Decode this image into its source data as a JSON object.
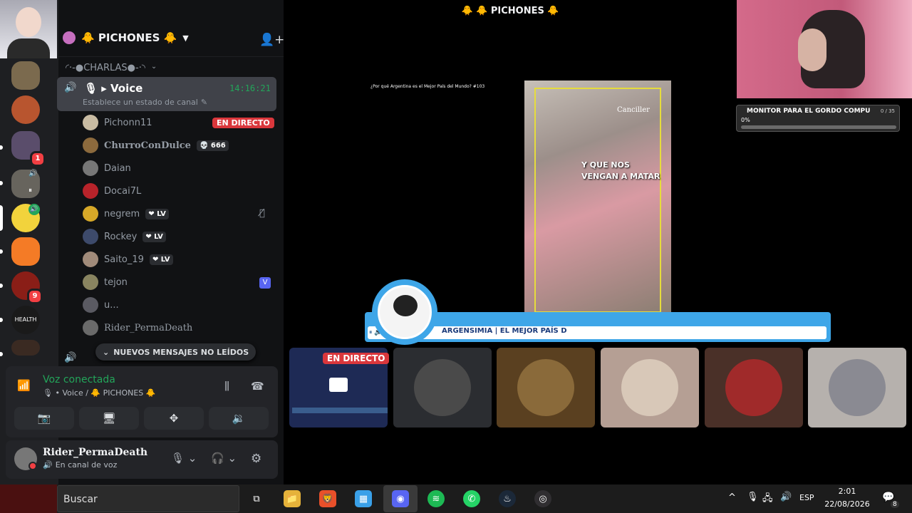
{
  "server": {
    "name": "🐥 PICHONES 🐥",
    "top_title": "🐥 🐥 PICHONES 🐥"
  },
  "category": {
    "label": "◜·-●CHARLAS●-·◝"
  },
  "channel": {
    "name": "🎙 ▸ Voice",
    "timer": "14:16:21",
    "status_placeholder": "Establece un estado de canal"
  },
  "members": [
    {
      "name": "Pichonn11",
      "tag": "EN DIRECTO"
    },
    {
      "name": "ChurroConDulce",
      "tag": "💀 666"
    },
    {
      "name": "Daian",
      "tag": ""
    },
    {
      "name": "Docai7L",
      "tag": ""
    },
    {
      "name": "negrem",
      "tag": "❤ LV"
    },
    {
      "name": "Rockey",
      "tag": "❤ LV"
    },
    {
      "name": "Saito_19",
      "tag": "❤ LV"
    },
    {
      "name": "tejon",
      "tag": ""
    },
    {
      "name": "u...",
      "tag": ""
    },
    {
      "name": "Rider_PermaDeath",
      "tag": ""
    }
  ],
  "new_messages": "NUEVOS MENSAJES NO LEÍDOS",
  "voice_panel": {
    "status": "Voz conectada",
    "location": "🎙 • Voice / 🐥 PICHONES 🐥"
  },
  "user": {
    "name": "Rider_PermaDeath",
    "status": "En canal de voz"
  },
  "stream": {
    "video_title": "¿Por qué Argentina es el Mejor País del Mundo? #103",
    "caption_1": "Y QUE NOS",
    "caption_2": "VENGAN A MATAR",
    "watermark": "Canciller",
    "ticker": "ARGENSIMIA | EL MEJOR PAÍS D"
  },
  "live_badge": "EN DIRECTO",
  "overlay": {
    "title": "MONITOR PARA EL GORDO COMPU",
    "count": "0 / 35",
    "percent": "0%",
    "progress": 0
  },
  "rail_badges": {
    "b1": "1",
    "b2": "9"
  },
  "taskbar": {
    "search": "Buscar",
    "lang": "ESP",
    "time": "2:01",
    "date": "22/08/2026",
    "notifications": "8"
  },
  "colors": {
    "accent_green": "#23a55a",
    "live_red": "#da373c",
    "blurple": "#5865f2"
  }
}
